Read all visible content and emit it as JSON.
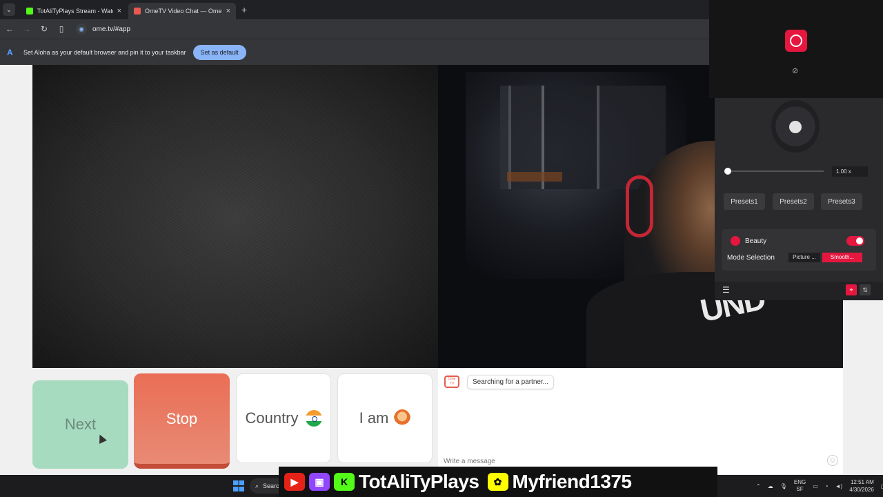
{
  "browser": {
    "tabs": [
      {
        "title": "TotAliTyPlays Stream - Watch Li",
        "favicon_color": "#53fc18"
      },
      {
        "title": "OmeTV Video Chat — Ome",
        "favicon_color": "#e85a4f"
      }
    ],
    "url": "ome.tv/#app",
    "infobar_message": "Set Aloha as your default browser and pin it to your taskbar",
    "infobar_button": "Set as default"
  },
  "controls": {
    "next_label": "Next",
    "stop_label": "Stop",
    "country_label": "Country",
    "iam_label": "I am"
  },
  "chat": {
    "status": "Searching for a partner...",
    "placeholder": "Write a message",
    "logo_text": "Ome TV"
  },
  "effects_panel": {
    "zoom": "1.00 x",
    "presets": [
      "Presets1",
      "Presets2",
      "Presets3"
    ],
    "beauty_label": "Beauty",
    "beauty_enabled": true,
    "mode_selection_label": "Mode Selection",
    "modes": [
      "Picture ...",
      "Smooth..."
    ],
    "active_mode": "Smooth..."
  },
  "video_right": {
    "shirt_text": "UND"
  },
  "stream_overlay": {
    "channel": "TotAliTyPlays",
    "snap": "Myfriend1375"
  },
  "taskbar": {
    "search_label": "Search",
    "lang": "ENG",
    "region": "SF",
    "time": "12:51 AM",
    "date": "4/30/2026"
  },
  "colors": {
    "accent": "#e5173f",
    "next": "#a6dbbf",
    "stop": "#ea6e55"
  }
}
